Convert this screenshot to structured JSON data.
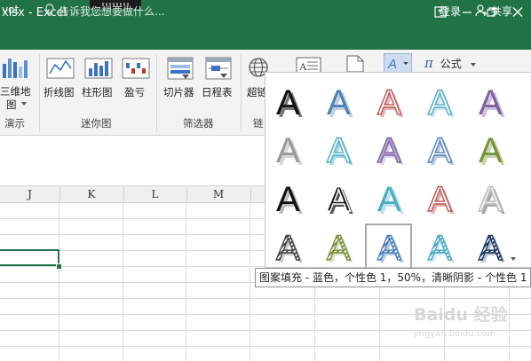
{
  "title_bar": {
    "title": "xlsx - Excel"
  },
  "menu_bar": {
    "tab_partial": "vot",
    "tell_me": "告诉我您想要做什么...",
    "login": "登录",
    "share": "共享"
  },
  "ribbon": {
    "map_label_1": "三维地",
    "map_label_2": "图",
    "group_tours": "演示",
    "sparkline_line": "折线图",
    "sparkline_column": "柱形图",
    "sparkline_winloss": "盈亏",
    "group_sparklines": "迷你图",
    "slicer": "切片器",
    "timeline": "日程表",
    "group_filters": "筛选器",
    "hyperlink_partial": "超链",
    "group_links_partial": "链",
    "formula": "公式"
  },
  "columns": [
    "J",
    "K",
    "L",
    "M"
  ],
  "wordart_gallery": {
    "letter": "A",
    "styles": [
      "填充 - 黑色，文本 1，阴影",
      "填充 - 蓝色，着色 1，阴影",
      "填充 - 白色，轮廓 - 着色 2，清晰阴影 - 着色 2",
      "填充 - 白色，轮廓 - 着色 1，阴影",
      "填充 - 紫色，着色 4，软棱台",
      "填充 - 灰色 50%，着色 3，清晰阴影 - 着色 3",
      "填充 - 白色，轮廓 - 着色 1，发光 - 着色 1",
      "填充 - 紫色，着色 4，清晰阴影",
      "填充 - 白色，轮廓 - 着色 1，清晰阴影",
      "填充 - 绿色，着色 6，内部阴影",
      "填充 - 黑色，清晰阴影 - 白色",
      "填充 - 黑色，文本 1，轮廓 - 背景 1，清晰阴影",
      "填充 - 蓝色，着色 5，轮廓 - 背景 1",
      "填充 - 白色，轮廓 - 着色 2，清晰阴影 - 着色 2",
      "填充 - 白色，着色 3，阴影",
      "图案填充 - 灰色，个性色 3，窄横线",
      "图案填充 - 绿色，个性色 6",
      "图案填充 - 蓝色，个性色 1，50%，清晰阴影 - 个性色 1",
      "图案填充 - 蓝色，个性色 5",
      "图案填充 - 深蓝，个性色 1"
    ]
  },
  "tooltip": "图案填充 - 蓝色，个性色 1，50%，清晰阴影 - 个性色 1",
  "watermark": {
    "text": "Baidu 经验",
    "url": "jingyan.baidu.com"
  }
}
